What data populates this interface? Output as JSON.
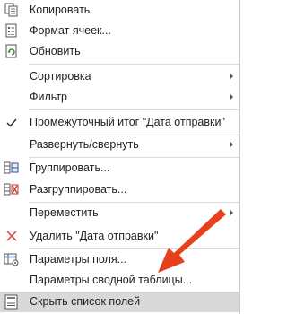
{
  "menu": {
    "items": [
      {
        "id": "copy",
        "label": "Копировать",
        "icon": "copy-icon",
        "has_submenu": false,
        "hovered": false
      },
      {
        "id": "format",
        "label": "Формат ячеек...",
        "icon": "format-cells-icon",
        "has_submenu": false,
        "hovered": false
      },
      {
        "id": "refresh",
        "label": "Обновить",
        "icon": "refresh-icon",
        "has_submenu": false,
        "hovered": false
      },
      {
        "id": "sort",
        "label": "Сортировка",
        "icon": "",
        "has_submenu": true,
        "hovered": false
      },
      {
        "id": "filter",
        "label": "Фильтр",
        "icon": "",
        "has_submenu": true,
        "hovered": false
      },
      {
        "id": "subtotal",
        "label": "Промежуточный итог \"Дата отправки\"",
        "icon": "checkmark-icon",
        "has_submenu": false,
        "hovered": false
      },
      {
        "id": "expand",
        "label": "Развернуть/свернуть",
        "icon": "",
        "has_submenu": true,
        "hovered": false
      },
      {
        "id": "group",
        "label": "Группировать...",
        "icon": "group-icon",
        "has_submenu": false,
        "hovered": false
      },
      {
        "id": "ungroup",
        "label": "Разгруппировать...",
        "icon": "ungroup-icon",
        "has_submenu": false,
        "hovered": false
      },
      {
        "id": "move",
        "label": "Переместить",
        "icon": "",
        "has_submenu": true,
        "hovered": false
      },
      {
        "id": "delete",
        "label": "Удалить \"Дата отправки\"",
        "icon": "delete-x-icon",
        "has_submenu": false,
        "hovered": false
      },
      {
        "id": "field_settings",
        "label": "Параметры поля...",
        "icon": "field-settings-icon",
        "has_submenu": false,
        "hovered": false
      },
      {
        "id": "pivot_options",
        "label": "Параметры сводной таблицы...",
        "icon": "",
        "has_submenu": false,
        "hovered": false
      },
      {
        "id": "hide_field_list",
        "label": "Скрыть список полей",
        "icon": "field-list-icon",
        "has_submenu": false,
        "hovered": true
      }
    ]
  },
  "colors": {
    "arrow": "#e8401c",
    "hover": "#d9d9d9",
    "delete_x": "#d9534f",
    "refresh": "#3a8a3a"
  }
}
